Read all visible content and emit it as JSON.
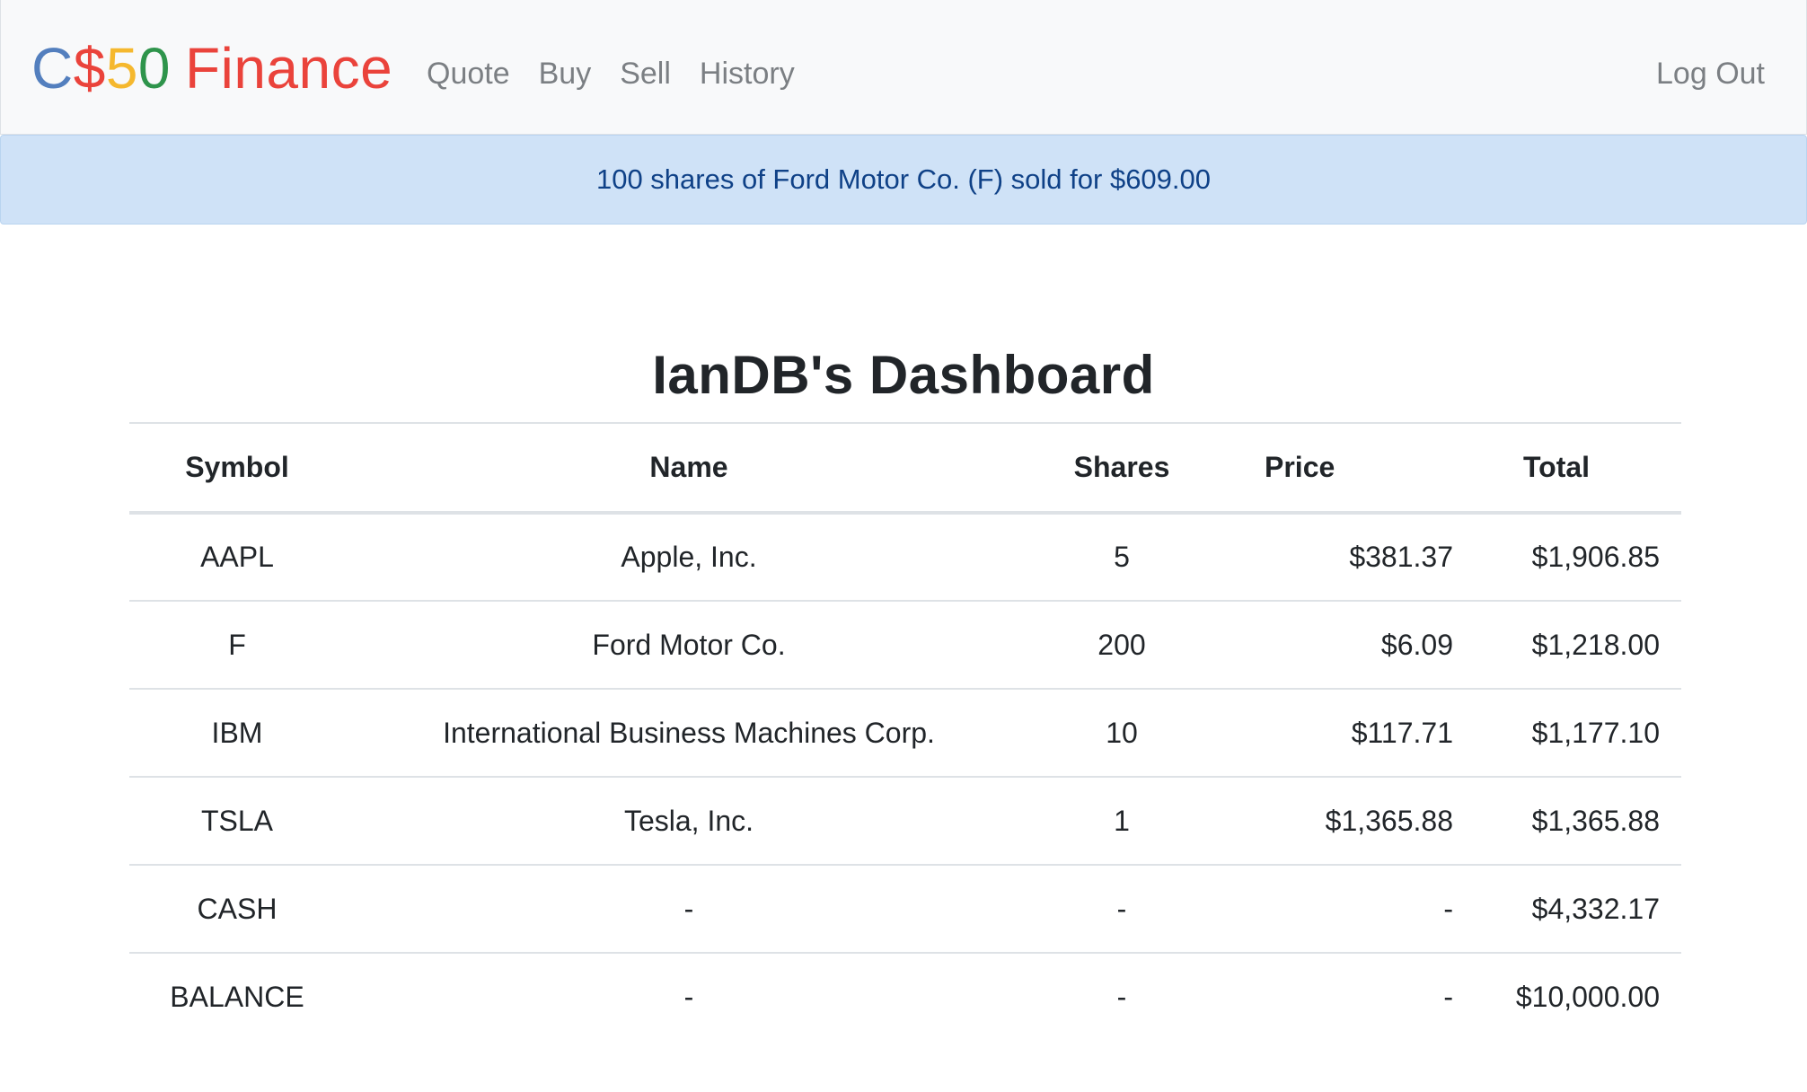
{
  "navbar": {
    "brand": {
      "c": "C",
      "dollar": "$",
      "five": "5",
      "zero": "0",
      "finance": "Finance"
    },
    "links": [
      {
        "label": "Quote"
      },
      {
        "label": "Buy"
      },
      {
        "label": "Sell"
      },
      {
        "label": "History"
      }
    ],
    "logout_label": "Log Out"
  },
  "alert": {
    "message": "100 shares of Ford Motor Co. (F) sold for $609.00"
  },
  "main": {
    "title": "IanDB's Dashboard",
    "table": {
      "headers": {
        "symbol": "Symbol",
        "name": "Name",
        "shares": "Shares",
        "price": "Price",
        "total": "Total"
      },
      "rows": [
        {
          "symbol": "AAPL",
          "name": "Apple, Inc.",
          "shares": "5",
          "price": "$381.37",
          "total": "$1,906.85"
        },
        {
          "symbol": "F",
          "name": "Ford Motor Co.",
          "shares": "200",
          "price": "$6.09",
          "total": "$1,218.00"
        },
        {
          "symbol": "IBM",
          "name": "International Business Machines Corp.",
          "shares": "10",
          "price": "$117.71",
          "total": "$1,177.10"
        },
        {
          "symbol": "TSLA",
          "name": "Tesla, Inc.",
          "shares": "1",
          "price": "$1,365.88",
          "total": "$1,365.88"
        },
        {
          "symbol": "CASH",
          "name": "-",
          "shares": "-",
          "price": "-",
          "total": "$4,332.17"
        },
        {
          "symbol": "BALANCE",
          "name": "-",
          "shares": "-",
          "price": "-",
          "total": "$10,000.00"
        }
      ]
    }
  },
  "colors": {
    "brand_blue": "#537fbe",
    "brand_red": "#ea433b",
    "brand_yellow": "#f5b82e",
    "brand_green": "#2e944b",
    "alert_background": "#cfe2f7",
    "alert_text": "#0f4187",
    "navbar_background": "#f8f9fa"
  }
}
